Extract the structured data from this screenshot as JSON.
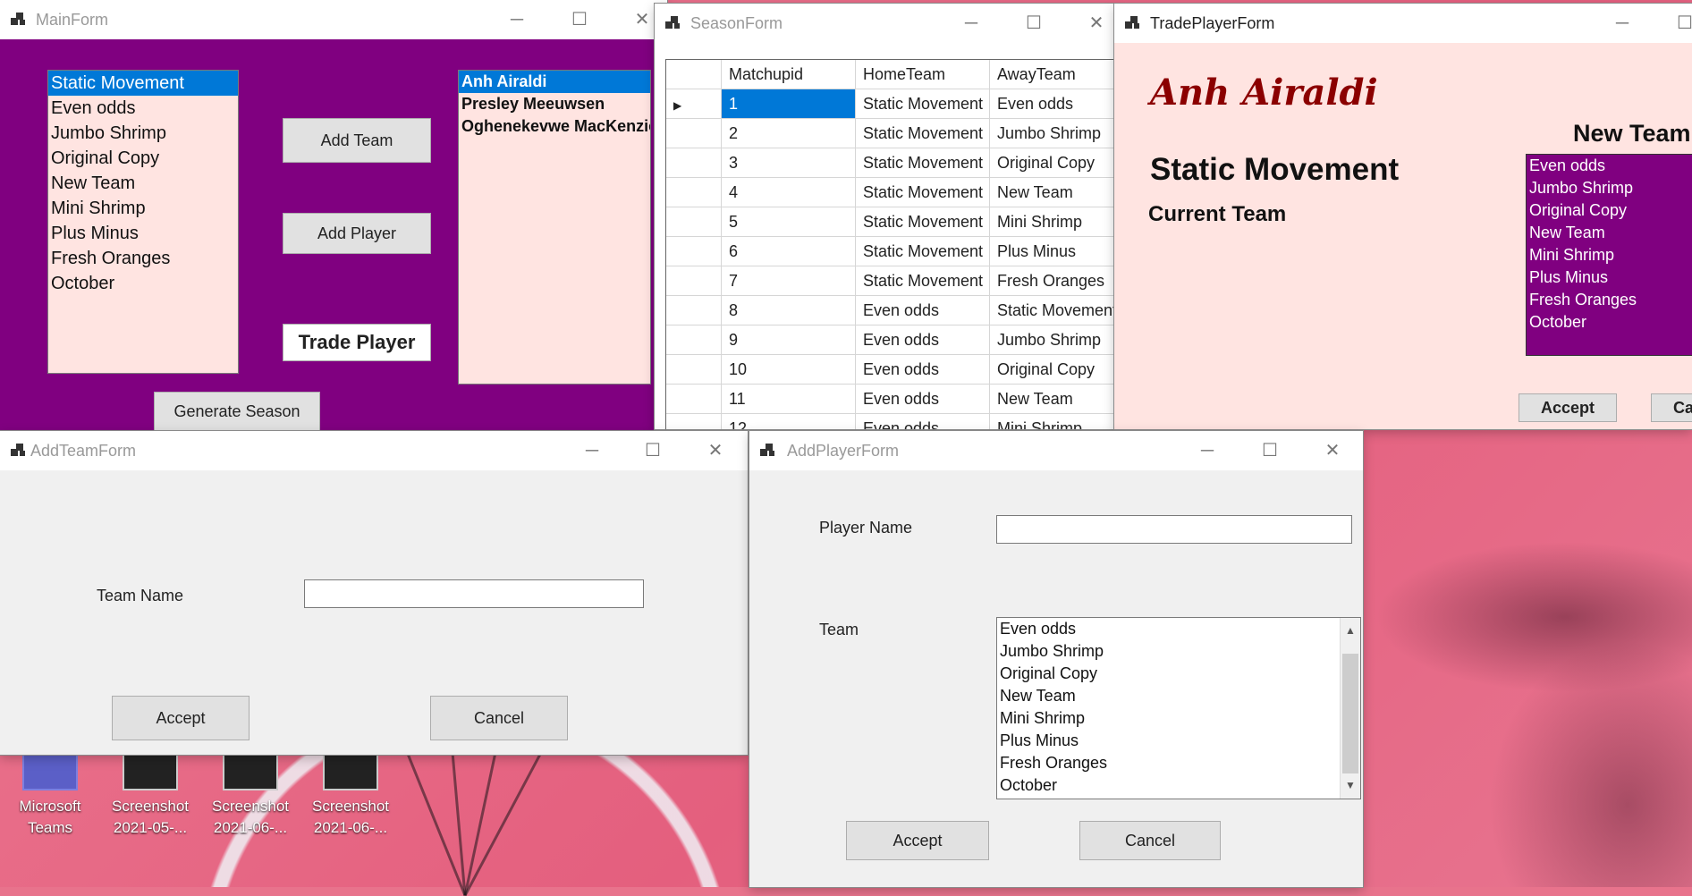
{
  "main_form": {
    "title": "MainForm",
    "teams": [
      "Static Movement",
      "Even odds",
      "Jumbo Shrimp",
      "Original Copy",
      "New Team",
      "Mini Shrimp",
      "Plus Minus",
      "Fresh Oranges",
      "October"
    ],
    "players": [
      "Anh Airaldi",
      "Presley Meeuwsen",
      "Oghenekevwe MacKenzie"
    ],
    "add_team_label": "Add Team",
    "add_player_label": "Add Player",
    "trade_player_label": "Trade Player",
    "generate_season_label": "Generate Season",
    "colors": {
      "background": "#800080",
      "list_bg": "#ffe4e1",
      "selection": "#0078d7"
    }
  },
  "season_form": {
    "title": "SeasonForm",
    "columns": [
      "Matchupid",
      "HomeTeam",
      "AwayTeam"
    ],
    "rows": [
      [
        "1",
        "Static Movement",
        "Even odds"
      ],
      [
        "2",
        "Static Movement",
        "Jumbo Shrimp"
      ],
      [
        "3",
        "Static Movement",
        "Original Copy"
      ],
      [
        "4",
        "Static Movement",
        "New Team"
      ],
      [
        "5",
        "Static Movement",
        "Mini Shrimp"
      ],
      [
        "6",
        "Static Movement",
        "Plus Minus"
      ],
      [
        "7",
        "Static Movement",
        "Fresh Oranges"
      ],
      [
        "8",
        "Even odds",
        "Static Movement"
      ],
      [
        "9",
        "Even odds",
        "Jumbo Shrimp"
      ],
      [
        "10",
        "Even odds",
        "Original Copy"
      ],
      [
        "11",
        "Even odds",
        "New Team"
      ],
      [
        "12",
        "Even odds",
        "Mini Shrimp"
      ]
    ],
    "current_row_icon": "row-pointer-icon"
  },
  "trade_form": {
    "title": "TradePlayerForm",
    "player_name": "Anh Airaldi",
    "current_team": "Static Movement",
    "current_team_label": "Current Team",
    "new_team_label": "New Team",
    "teams": [
      "Even odds",
      "Jumbo Shrimp",
      "Original Copy",
      "New Team",
      "Mini Shrimp",
      "Plus Minus",
      "Fresh Oranges",
      "October"
    ],
    "accept_label": "Accept",
    "cancel_label": "Ca",
    "colors": {
      "background": "#ffe4e1",
      "player_name": "#8b0000",
      "list_bg": "#800080"
    }
  },
  "add_team_form": {
    "title": "AddTeamForm",
    "team_name_label": "Team Name",
    "team_name_value": "",
    "accept_label": "Accept",
    "cancel_label": "Cancel"
  },
  "add_player_form": {
    "title": "AddPlayerForm",
    "player_name_label": "Player Name",
    "player_name_value": "",
    "team_label": "Team",
    "teams": [
      "Even odds",
      "Jumbo Shrimp",
      "Original Copy",
      "New Team",
      "Mini Shrimp",
      "Plus Minus",
      "Fresh Oranges",
      "October"
    ],
    "accept_label": "Accept",
    "cancel_label": "Cancel"
  },
  "desktop": {
    "icons": [
      {
        "label_1": "Microsoft",
        "label_2": "Teams"
      },
      {
        "label_1": "Screenshot",
        "label_2": "2021-05-..."
      },
      {
        "label_1": "Screenshot",
        "label_2": "2021-06-..."
      },
      {
        "label_1": "Screenshot",
        "label_2": "2021-06-..."
      }
    ]
  },
  "window_controls": {
    "minimize": "─",
    "maximize": "☐",
    "close": "✕"
  }
}
